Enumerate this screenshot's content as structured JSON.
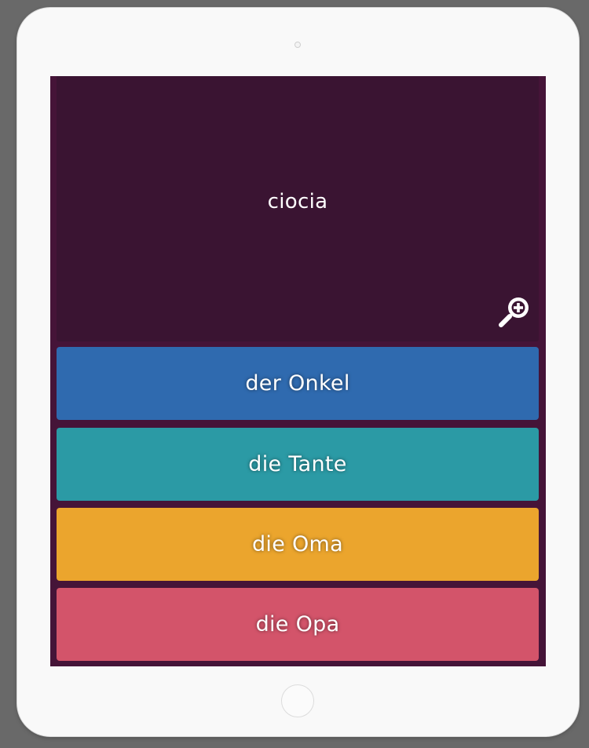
{
  "quiz": {
    "prompt": "ciocia",
    "answers": [
      {
        "label": "der Onkel",
        "color": "#2f6aaf"
      },
      {
        "label": "die Tante",
        "color": "#2b9aa5"
      },
      {
        "label": "die Oma",
        "color": "#eba52d"
      },
      {
        "label": "die Opa",
        "color": "#d3546a"
      }
    ]
  },
  "icons": {
    "zoom": "zoom-in-icon",
    "camera": "camera-icon",
    "home": "home-button"
  },
  "colors": {
    "background": "#696969",
    "device": "#f9f9f9",
    "screen": "#451438",
    "prompt_card": "#3a1432"
  }
}
